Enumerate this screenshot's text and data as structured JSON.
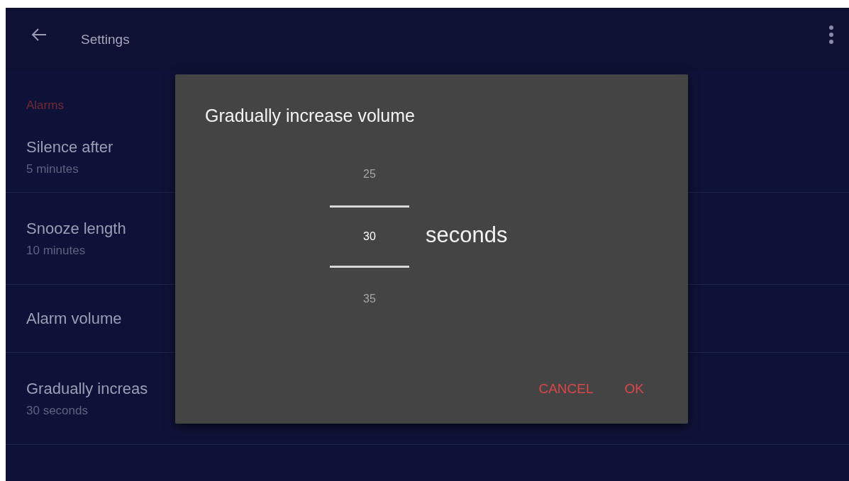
{
  "app_bar": {
    "title": "Settings"
  },
  "section": {
    "title": "Alarms"
  },
  "settings": [
    {
      "title": "Silence after",
      "summary": "5 minutes"
    },
    {
      "title": "Snooze length",
      "summary": "10 minutes"
    },
    {
      "title": "Alarm volume"
    },
    {
      "title": "Gradually increas",
      "summary": "30 seconds"
    }
  ],
  "dialog": {
    "title": "Gradually increase volume",
    "picker": [
      {
        "label": "25",
        "selected": false
      },
      {
        "label": "30",
        "selected": true
      },
      {
        "label": "35",
        "selected": false
      }
    ],
    "unit": "seconds",
    "buttons": [
      "CANCEL",
      "OK"
    ]
  }
}
